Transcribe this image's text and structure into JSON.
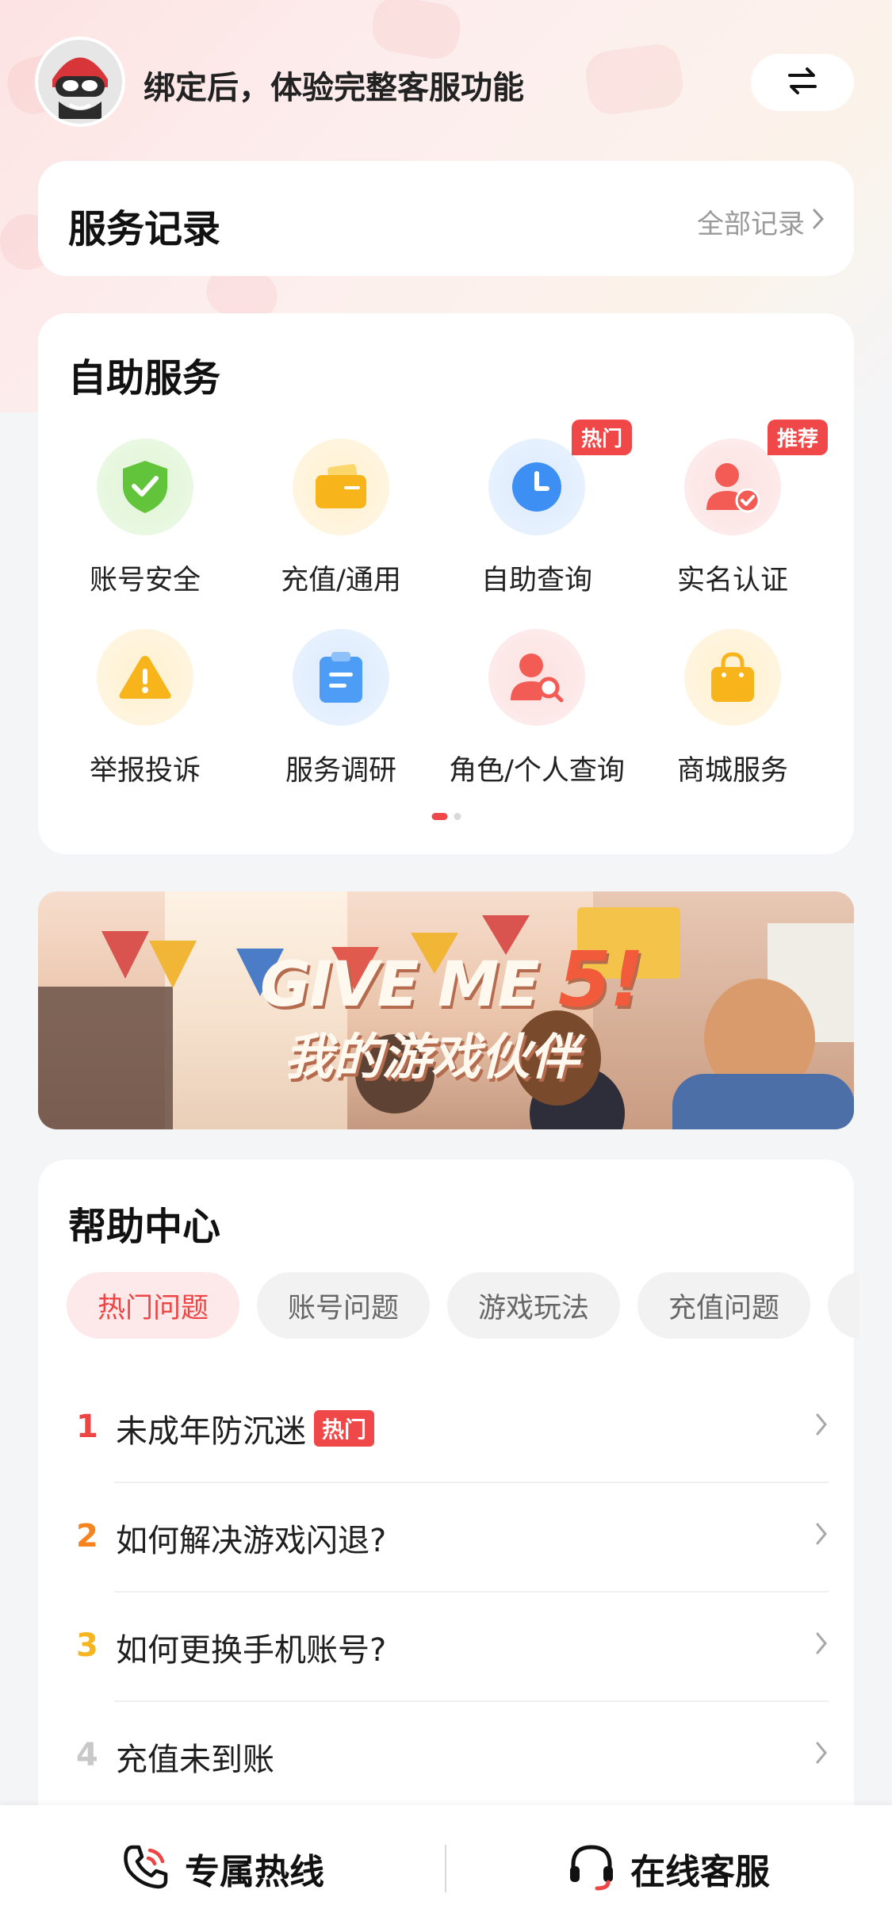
{
  "header": {
    "bind_prompt": "绑定后，体验完整客服功能",
    "switch_icon": "swap-arrows-icon"
  },
  "records": {
    "title": "服务记录",
    "all_link": "全部记录"
  },
  "self_service": {
    "title": "自助服务",
    "items": [
      {
        "label": "账号安全",
        "icon": "shield-check-icon",
        "color": "#66c93f",
        "bg": "#e9f8e2"
      },
      {
        "label": "充值/通用",
        "icon": "wallet-icon",
        "color": "#f8b51c",
        "bg": "#fff4dc"
      },
      {
        "label": "自助查询",
        "icon": "clock-icon",
        "color": "#3d8ff3",
        "bg": "#e5f0fd",
        "badge": "热门"
      },
      {
        "label": "实名认证",
        "icon": "user-verified-icon",
        "color": "#f35b55",
        "bg": "#fde9e9",
        "badge": "推荐"
      },
      {
        "label": "举报投诉",
        "icon": "warning-icon",
        "color": "#f8b51c",
        "bg": "#fff4dc"
      },
      {
        "label": "服务调研",
        "icon": "clipboard-icon",
        "color": "#4d9cf5",
        "bg": "#e5f0fd"
      },
      {
        "label": "角色/个人查询",
        "icon": "user-search-icon",
        "color": "#f35b55",
        "bg": "#fde9e9"
      },
      {
        "label": "商城服务",
        "icon": "shopping-bag-icon",
        "color": "#f8b51c",
        "bg": "#fff4dc"
      }
    ],
    "page_indicator": {
      "current": 1,
      "total": 2
    }
  },
  "banner": {
    "headline_text": "GIVE ME ",
    "headline_number": "5!",
    "subline": "我的游戏伙伴"
  },
  "help": {
    "title": "帮助中心",
    "tabs": [
      {
        "label": "热门问题",
        "active": true
      },
      {
        "label": "账号问题",
        "active": false
      },
      {
        "label": "游戏玩法",
        "active": false
      },
      {
        "label": "充值问题",
        "active": false
      },
      {
        "label": "",
        "active": false
      }
    ],
    "faq": [
      {
        "num": "1",
        "question": "未成年防沉迷",
        "hot": "热门",
        "num_color": "#ef4444"
      },
      {
        "num": "2",
        "question": "如何解决游戏闪退?",
        "num_color": "#f5841f"
      },
      {
        "num": "3",
        "question": "如何更换手机账号?",
        "num_color": "#f5b51f"
      },
      {
        "num": "4",
        "question": "充值未到账",
        "num_color": "#c8c8c8"
      }
    ]
  },
  "bottom_bar": {
    "hotline": "专属热线",
    "hotline_icon": "phone-icon",
    "online": "在线客服",
    "online_icon": "headset-icon"
  },
  "colors": {
    "accent": "#ef4444",
    "page_bg": "#f4f5f7"
  }
}
